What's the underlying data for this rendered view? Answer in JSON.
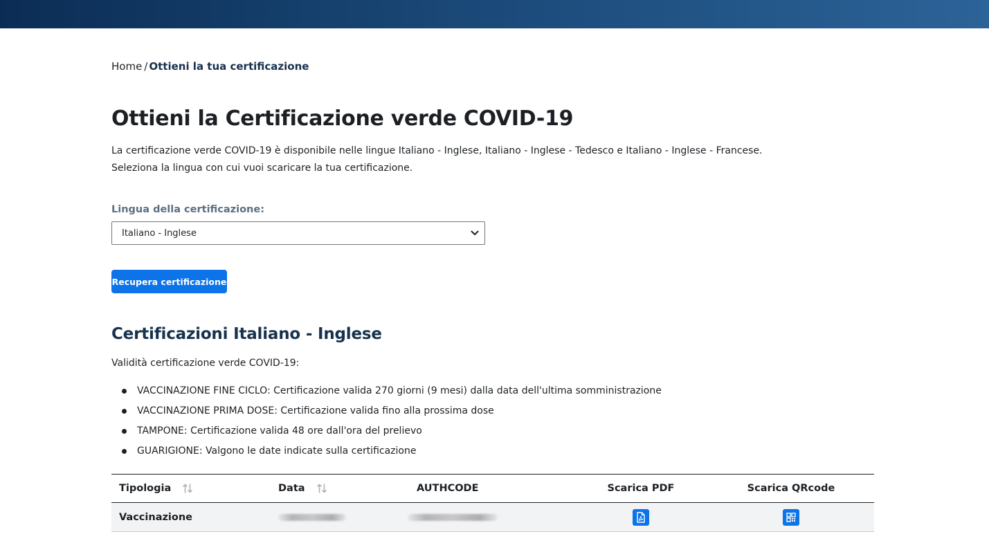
{
  "colors": {
    "header_bar_start": "#0b2d55",
    "header_bar_end": "#2c6398",
    "primary": "#0c73e8",
    "heading": "#17324d",
    "label": "#5c6f82"
  },
  "breadcrumb": {
    "home": "Home",
    "separator": "/",
    "current": "Ottieni la tua certificazione"
  },
  "page": {
    "title": "Ottieni la Certificazione verde COVID-19",
    "intro_line1": "La certificazione verde COVID-19 è disponibile nelle lingue Italiano - Inglese, Italiano - Inglese - Tedesco e Italiano - Inglese - Francese.",
    "intro_line2": "Seleziona la lingua con cui vuoi scaricare la tua certificazione."
  },
  "language_select": {
    "label": "Lingua della certificazione:",
    "selected": "Italiano - Inglese",
    "icon": "chevron-down-icon"
  },
  "retrieve_button": {
    "label": "Recupera certificazione"
  },
  "certifications": {
    "heading": "Certificazioni Italiano - Inglese",
    "validity_label": "Validità certificazione verde COVID-19:",
    "rules": [
      "VACCINAZIONE FINE CICLO: Certificazione valida 270 giorni (9 mesi) dalla data dell'ultima somministrazione",
      "VACCINAZIONE PRIMA DOSE: Certificazione valida fino alla prossima dose",
      "TAMPONE: Certificazione valida 48 ore dall'ora del prelievo",
      "GUARIGIONE: Valgono le date indicate sulla certificazione"
    ]
  },
  "table": {
    "columns": {
      "type": "Tipologia",
      "date": "Data",
      "authcode": "AUTHCODE",
      "pdf": "Scarica PDF",
      "qr": "Scarica QRcode"
    },
    "sort_icon": "sort-arrows-icon",
    "rows": [
      {
        "type": "Vaccinazione",
        "date": "",
        "authcode": "",
        "pdf_icon": "pdf-file-icon",
        "qr_icon": "qr-code-icon"
      }
    ]
  }
}
